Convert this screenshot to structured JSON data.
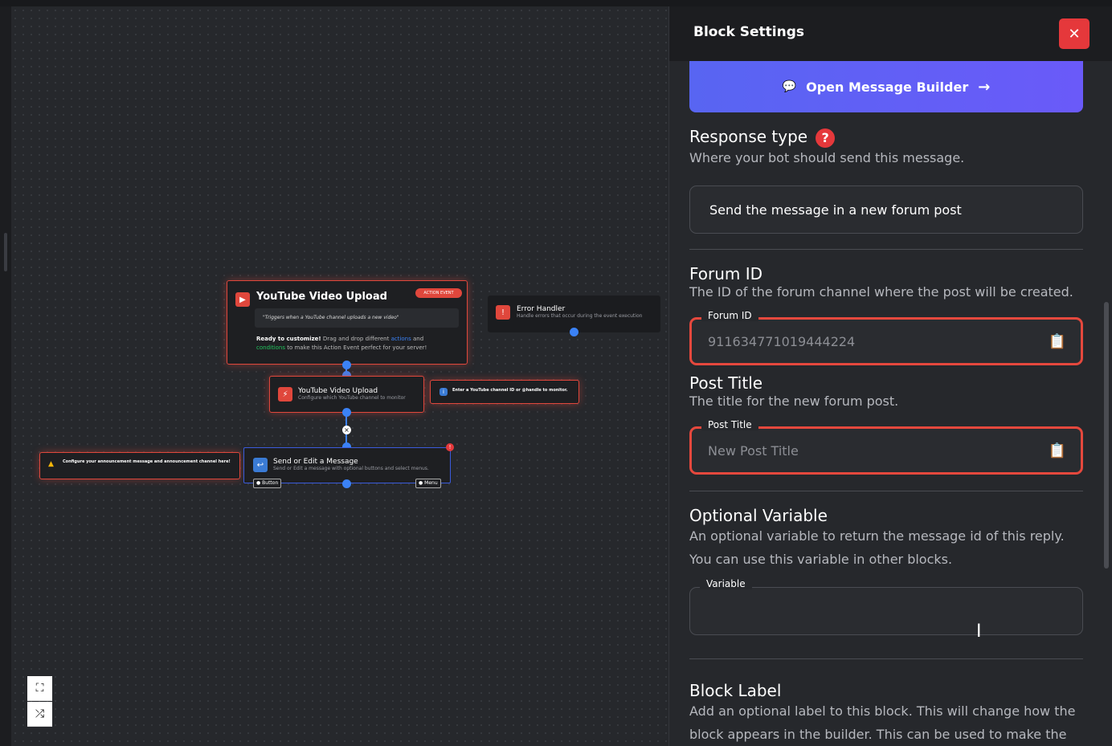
{
  "canvas": {
    "trigger": {
      "title": "YouTube Video Upload",
      "badge": "ACTION EVENT",
      "quote": "\"Triggers when a YouTube channel uploads a new video\"",
      "ready_bold": "Ready to customize!",
      "ready_text1": " Drag and drop different ",
      "ready_actions": "actions",
      "ready_text2": " and",
      "ready_conditions": "conditions",
      "ready_text3": " to make this Action Event perfect for your server!"
    },
    "error_handler": {
      "name": "Error Handler",
      "desc": "Handle errors that occur during the event execution"
    },
    "yt_block": {
      "name": "YouTube Video Upload",
      "desc": "Configure which YouTube channel to monitor"
    },
    "yt_hint": "Enter a YouTube channel ID or @handle to monitor.",
    "send_block": {
      "name": "Send or Edit a Message",
      "desc": "Send or Edit a message with optional buttons and select menus.",
      "btn_label": "Button",
      "menu_label": "Menu"
    },
    "send_hint": "Configure your announcement message and announcement channel here!"
  },
  "panel": {
    "title": "Block Settings",
    "close_label": "✕",
    "open_builder_label": "Open Message Builder",
    "response_type": {
      "title": "Response type",
      "desc": "Where your bot should send this message.",
      "value": "Send the message in a new forum post"
    },
    "forum_id": {
      "title": "Forum ID",
      "desc": "The ID of the forum channel where the post will be created.",
      "label": "Forum ID",
      "placeholder": "911634771019444224"
    },
    "post_title": {
      "title": "Post Title",
      "desc": "The title for the new forum post.",
      "label": "Post Title",
      "placeholder": "New Post Title"
    },
    "optional_variable": {
      "title": "Optional Variable",
      "desc": "An optional variable to return the message id of this reply. You can use this variable in other blocks.",
      "label": "Variable",
      "value": ""
    },
    "block_label": {
      "title": "Block Label",
      "desc": "Add an optional label to this block. This will change how the block appears in the builder. This can be used to make the"
    }
  },
  "colors": {
    "accent_red": "#e5383b",
    "accent_blue": "#5865f2",
    "node_dot": "#3b82f6"
  },
  "icons": [
    "close-icon",
    "chat-bubble-icon",
    "arrow-right-icon",
    "question-icon",
    "clipboard-icon",
    "fullscreen-icon",
    "shuffle-icon"
  ]
}
